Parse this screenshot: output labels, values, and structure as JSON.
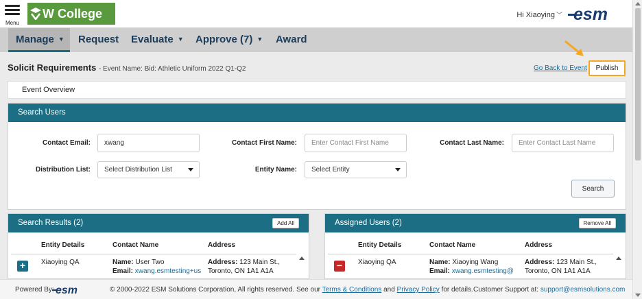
{
  "header": {
    "menu_label": "Menu",
    "logo_text": "W College",
    "greeting": "Hi Xiaoying",
    "esm_logo": "esm"
  },
  "nav": {
    "items": [
      {
        "label": "Manage",
        "has_caret": true,
        "active": true
      },
      {
        "label": "Request",
        "has_caret": false
      },
      {
        "label": "Evaluate",
        "has_caret": true
      },
      {
        "label": "Approve (7)",
        "has_caret": true
      },
      {
        "label": "Award",
        "has_caret": false
      }
    ]
  },
  "page": {
    "title": "Solicit Requirements",
    "subtitle": "- Event Name: Bid: Athletic Uniform 2022 Q1-Q2",
    "back_link": "Go Back to Event",
    "publish_label": "Publish",
    "overview_label": "Event Overview"
  },
  "search": {
    "title": "Search Users",
    "email_label": "Contact Email:",
    "email_value": "xwang",
    "first_label": "Contact First Name:",
    "first_placeholder": "Enter Contact First Name",
    "last_label": "Contact Last Name:",
    "last_placeholder": "Enter Contact Last Name",
    "dist_label": "Distribution List:",
    "dist_value": "Select Distribution List",
    "entity_label": "Entity Name:",
    "entity_value": "Select Entity",
    "search_button": "Search"
  },
  "results": {
    "title": "Search Results (2)",
    "action_button": "Add All",
    "columns": [
      "Entity Details",
      "Contact Name",
      "Address"
    ],
    "row": {
      "entity": "Xiaoying QA",
      "name_label": "Name:",
      "name": "User Two",
      "email_label": "Email:",
      "email": "xwang.esmtesting+us",
      "address_label": "Address:",
      "address_line1": "123 Main St.,",
      "address_line2": "Toronto, ON 1A1 A1A"
    }
  },
  "assigned": {
    "title": "Assigned Users (2)",
    "action_button": "Remove All",
    "columns": [
      "Entity Details",
      "Contact Name",
      "Address"
    ],
    "row": {
      "entity": "Xiaoying QA",
      "name_label": "Name:",
      "name": "Xiaoying Wang",
      "email_label": "Email:",
      "email": "xwang.esmtesting@",
      "address_label": "Address:",
      "address_line1": "123 Main St.,",
      "address_line2": "Toronto, ON 1A1 A1A"
    }
  },
  "footer": {
    "powered_by": "Powered By:",
    "copyright_pre": "© 2000-2022 ESM Solutions Corporation, All rights reserved. See our",
    "terms": "Terms & Conditions",
    "and": "and",
    "privacy": "Privacy Policy",
    "copyright_post": "for details.",
    "support_label": "Customer Support at:",
    "support_email": "support@esmsolutions.com"
  },
  "colors": {
    "brand_green": "#5a9a3e",
    "header_teal": "#1b6e84",
    "publish_border": "#f5a623",
    "remove_red": "#c62828"
  }
}
